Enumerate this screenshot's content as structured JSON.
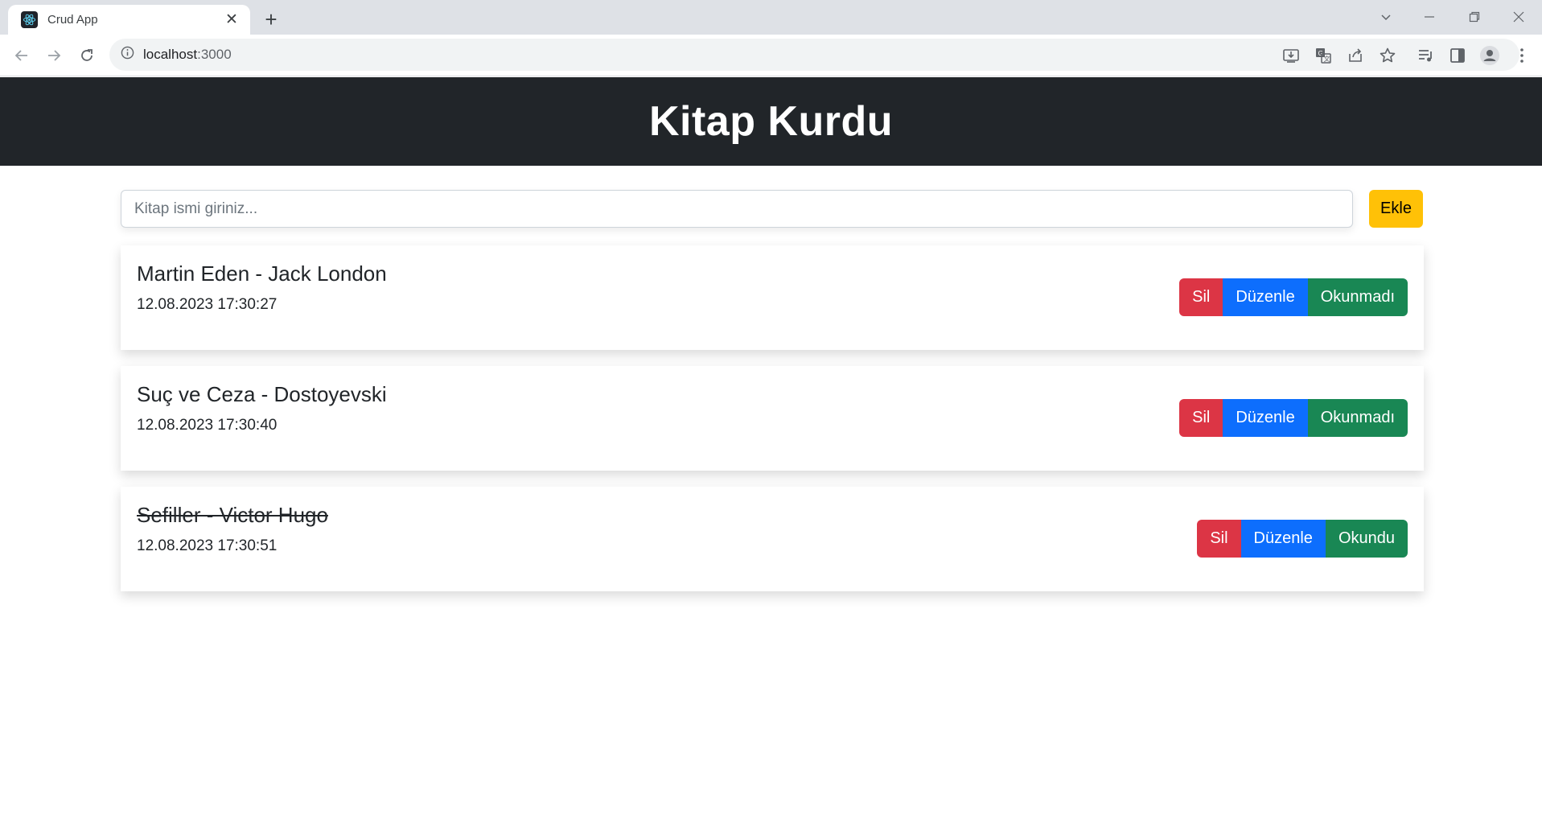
{
  "browser": {
    "tab_title": "Crud App",
    "url_host": "localhost",
    "url_port": ":3000"
  },
  "app": {
    "title": "Kitap Kurdu",
    "input_placeholder": "Kitap ismi giriniz...",
    "add_label": "Ekle"
  },
  "books": [
    {
      "title": "Martin Eden - Jack London",
      "date": "12.08.2023 17:30:27",
      "delete_label": "Sil",
      "edit_label": "Düzenle",
      "status_label": "Okunmadı",
      "read": false
    },
    {
      "title": "Suç ve Ceza - Dostoyevski",
      "date": "12.08.2023 17:30:40",
      "delete_label": "Sil",
      "edit_label": "Düzenle",
      "status_label": "Okunmadı",
      "read": false
    },
    {
      "title": "Sefiller - Victor Hugo",
      "date": "12.08.2023 17:30:51",
      "delete_label": "Sil",
      "edit_label": "Düzenle",
      "status_label": "Okundu",
      "read": true
    }
  ],
  "colors": {
    "header_bg": "#212529",
    "add_button": "#ffc107",
    "delete_button": "#dc3545",
    "edit_button": "#0d6efd",
    "status_button": "#198754"
  }
}
